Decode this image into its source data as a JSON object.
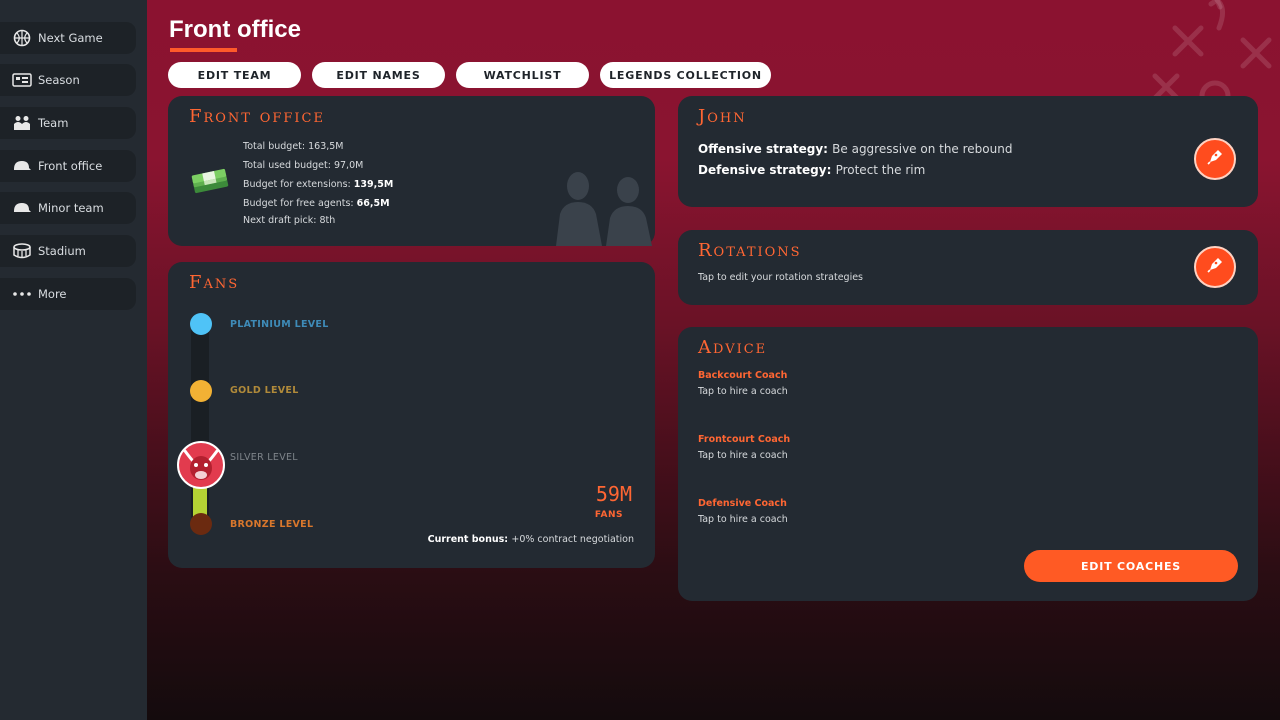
{
  "sidebar": {
    "items": [
      {
        "label": "Next Game",
        "icon": "basketball-icon"
      },
      {
        "label": "Season",
        "icon": "calendar-icon"
      },
      {
        "label": "Team",
        "icon": "team-icon"
      },
      {
        "label": "Front office",
        "icon": "cap-icon"
      },
      {
        "label": "Minor team",
        "icon": "cap-icon"
      },
      {
        "label": "Stadium",
        "icon": "stadium-icon"
      },
      {
        "label": "More",
        "icon": "more-icon"
      }
    ]
  },
  "header": {
    "title": "Front office",
    "tabs": [
      "EDIT TEAM",
      "EDIT NAMES",
      "WATCHLIST",
      "LEGENDS COLLECTION"
    ]
  },
  "front_office": {
    "title": "Front office",
    "total_budget": "Total budget: 163,5M",
    "total_used_budget": "Total used budget: 97,0M",
    "extensions_label": "Budget for extensions: ",
    "extensions_value": "139,5M",
    "free_agents_label": "Budget for free agents: ",
    "free_agents_value": "66,5M",
    "next_draft_pick": "Next draft pick: 8th"
  },
  "fans": {
    "title": "Fans",
    "levels": [
      {
        "label": "PLATINIUM LEVEL",
        "color": "#4fc3f7",
        "text_color": "#3e8bb8"
      },
      {
        "label": "GOLD LEVEL",
        "color": "#f2b134",
        "text_color": "#b08a3a"
      },
      {
        "label": "SILVER LEVEL",
        "color": "#9aa0a6",
        "text_color": "#7e848a"
      },
      {
        "label": "BRONZE LEVEL",
        "color": "#6b2a10",
        "text_color": "#d9772c"
      }
    ],
    "count": "59M",
    "count_label": "FANS",
    "bonus_label": "Current bonus: ",
    "bonus_value": "+0% contract negotiation",
    "progress_color": "#b5d334"
  },
  "coach": {
    "title": "John",
    "offensive_label": "Offensive strategy: ",
    "offensive_value": "Be aggressive on the rebound",
    "defensive_label": "Defensive strategy: ",
    "defensive_value": "Protect the rim"
  },
  "rotations": {
    "title": "Rotations",
    "subtitle": "Tap to edit your rotation strategies"
  },
  "advice": {
    "title": "Advice",
    "items": [
      {
        "role": "Backcourt Coach",
        "action": "Tap to hire a coach"
      },
      {
        "role": "Frontcourt Coach",
        "action": "Tap to hire a coach"
      },
      {
        "role": "Defensive Coach",
        "action": "Tap to hire a coach"
      }
    ],
    "edit_button": "EDIT COACHES"
  },
  "colors": {
    "accent": "#ff5a2a",
    "card_bg": "#232a32",
    "sidebar_bg": "#242a31"
  }
}
